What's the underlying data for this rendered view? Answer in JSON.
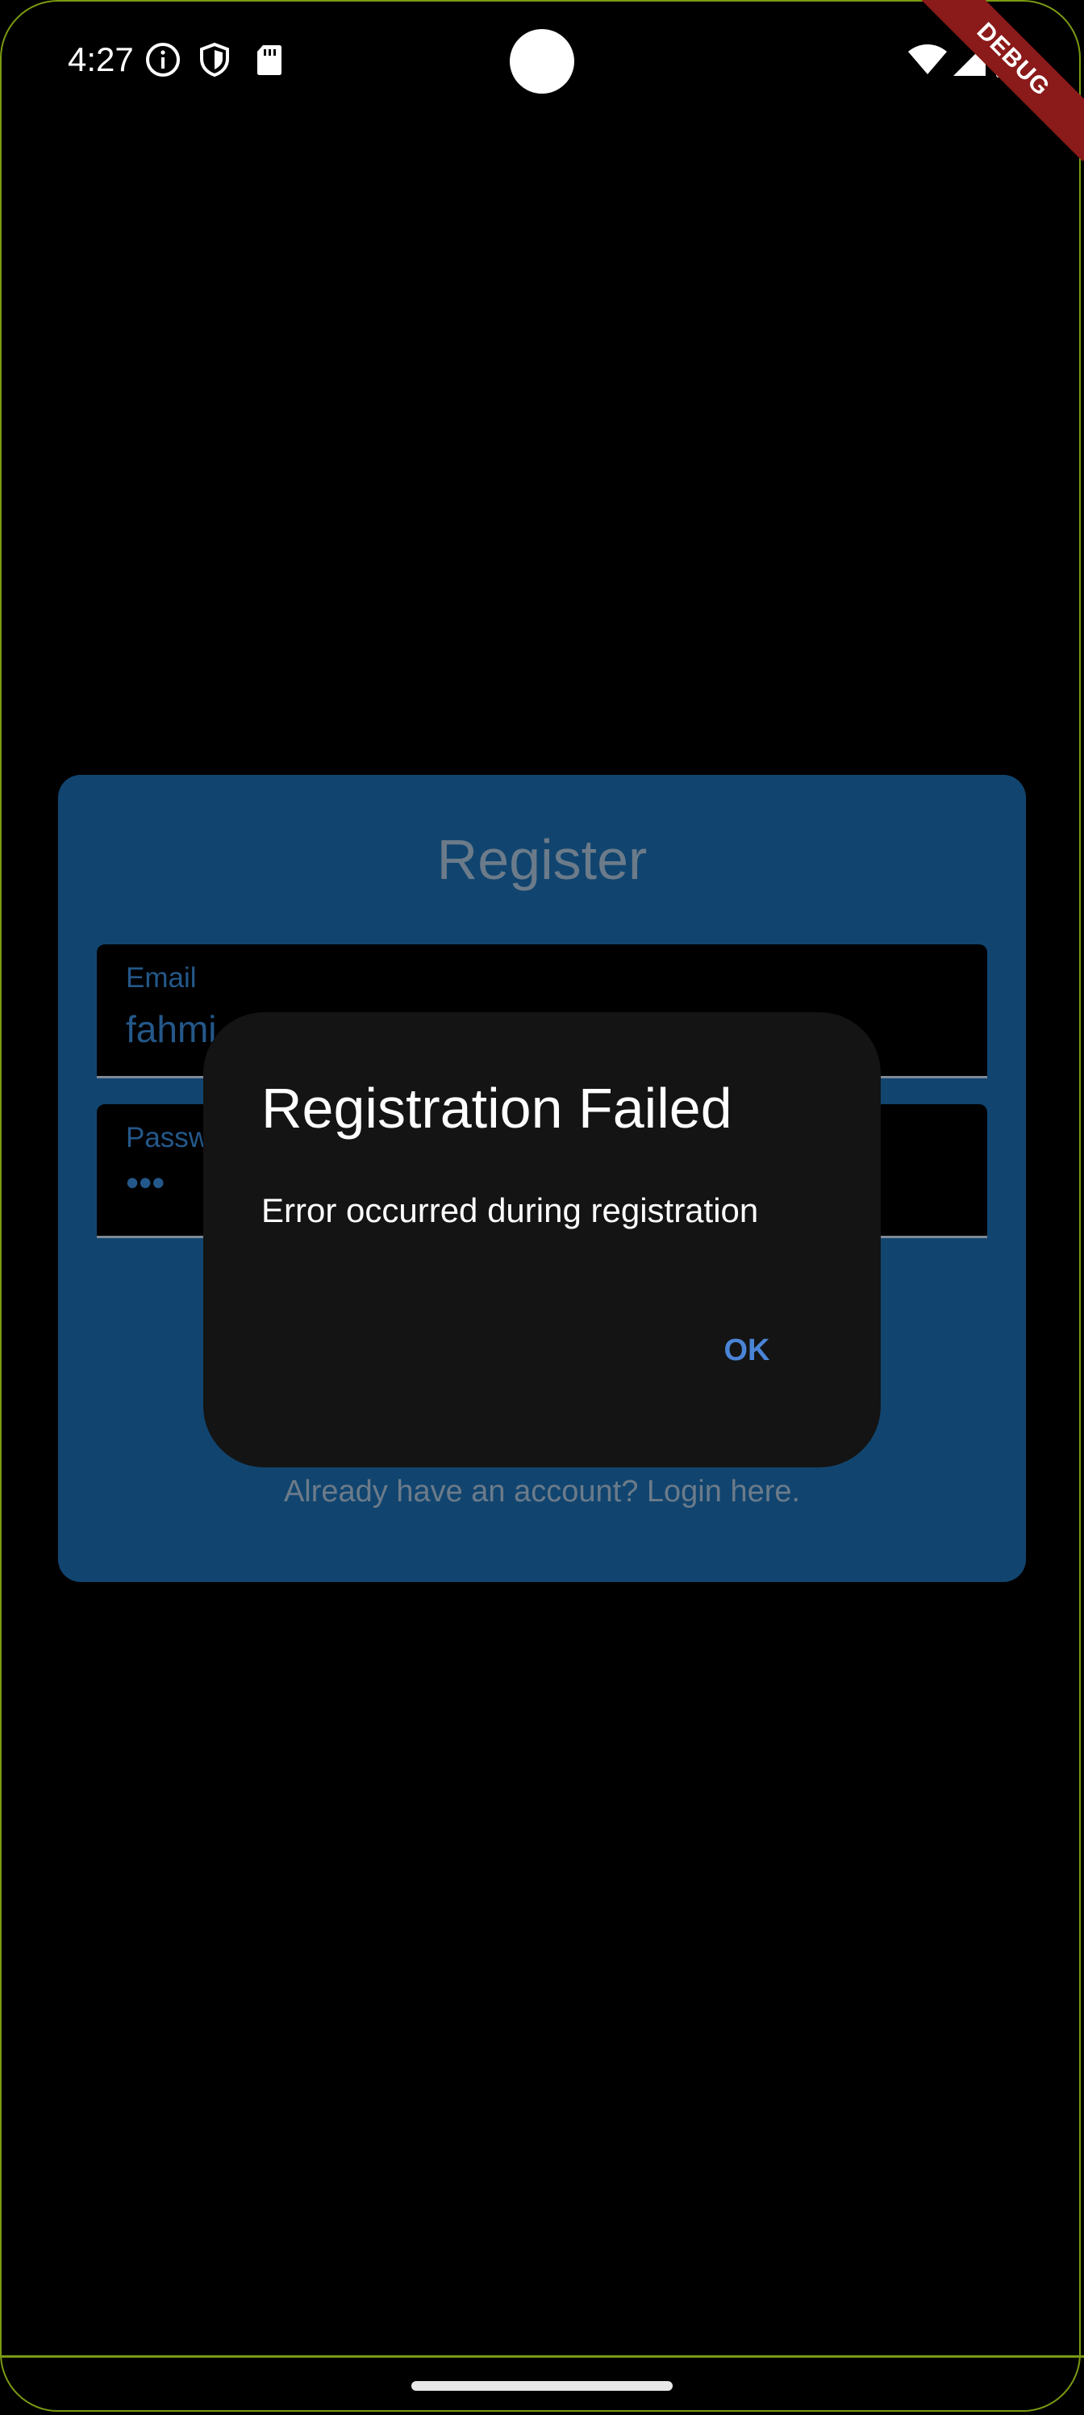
{
  "status_bar": {
    "time": "4:27",
    "icons_left": [
      "info-icon",
      "shield-icon",
      "sd-card-icon"
    ],
    "icons_right": [
      "wifi-icon",
      "signal-icon",
      "battery-icon"
    ],
    "debug_banner": "DEBUG"
  },
  "register_card": {
    "title": "Register",
    "email_label": "Email",
    "email_value": "fahmi",
    "password_label": "Passw",
    "password_value": "•••",
    "login_link": "Already have an account? Login here."
  },
  "dialog": {
    "title": "Registration Failed",
    "message": "Error occurred during registration",
    "ok_label": "OK"
  },
  "colors": {
    "card_background": "#11456f",
    "dialog_background": "#141414",
    "accent": "#4a84d6",
    "debug_banner": "#8b1a1a"
  }
}
